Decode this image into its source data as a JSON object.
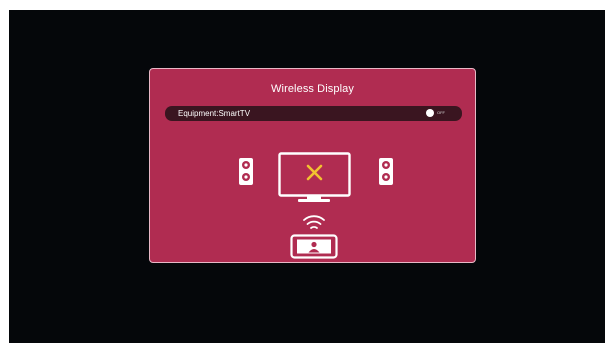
{
  "dialog": {
    "title": "Wireless Display",
    "equipment_label": "Equipment:SmartTV",
    "toggle": {
      "state_label": "OFF"
    }
  },
  "icons": {
    "speakers": "speaker-icon",
    "tv": "tv-icon",
    "x_mark": "close-icon",
    "wifi": "wifi-icon",
    "phone": "phone-icon"
  },
  "colors": {
    "screen_bg": "#05070a",
    "dialog_bg": "#b02c51",
    "bar_bg": "#3a1520",
    "x_mark": "#f2c230",
    "icon": "#ffffff"
  }
}
